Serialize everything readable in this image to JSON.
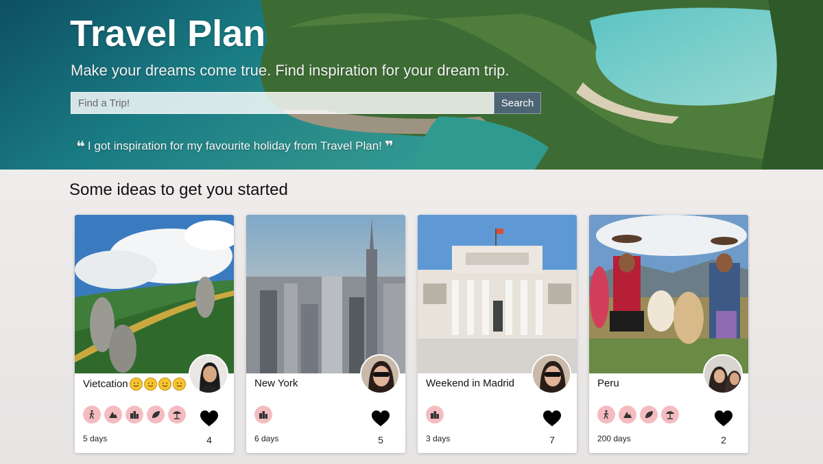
{
  "hero": {
    "title": "Travel Plan",
    "subtitle": "Make your dreams come true. Find inspiration for your dream trip.",
    "search": {
      "placeholder": "Find a Trip!",
      "value": "",
      "button_label": "Search"
    },
    "quote": "I got inspiration for my favourite holiday from Travel Plan!",
    "quote_open": "❝",
    "quote_close": "❞"
  },
  "section_title": "Some ideas to get you started",
  "colors": {
    "tag_bg": "#f4bcc0",
    "search_button": "#4d6473",
    "heart": "#000000"
  },
  "trips": [
    {
      "name": "Vietcation",
      "emoji_count": 4,
      "emoji_icon": "smiling-face-emoji",
      "image": "golden-bridge-hands-image",
      "avatar": "user-avatar-woman-long-hair",
      "tags": [
        "hiking-icon",
        "mountain-icon",
        "city-icon",
        "leaf-icon",
        "beach-umbrella-icon"
      ],
      "duration": "5 days",
      "likes": "4"
    },
    {
      "name": "New York",
      "emoji_count": 0,
      "image": "new-york-skyline-image",
      "avatar": "user-avatar-sunglasses",
      "tags": [
        "city-icon"
      ],
      "duration": "6 days",
      "likes": "5"
    },
    {
      "name": "Weekend in Madrid",
      "emoji_count": 0,
      "image": "prado-museum-image",
      "avatar": "user-avatar-sunglasses",
      "tags": [
        "city-icon"
      ],
      "duration": "3 days",
      "likes": "7"
    },
    {
      "name": "Peru",
      "emoji_count": 0,
      "image": "peru-llamas-image",
      "avatar": "user-avatar-two-people",
      "tags": [
        "hiking-icon",
        "mountain-icon",
        "leaf-icon",
        "beach-umbrella-icon"
      ],
      "duration": "200 days",
      "likes": "2"
    }
  ]
}
